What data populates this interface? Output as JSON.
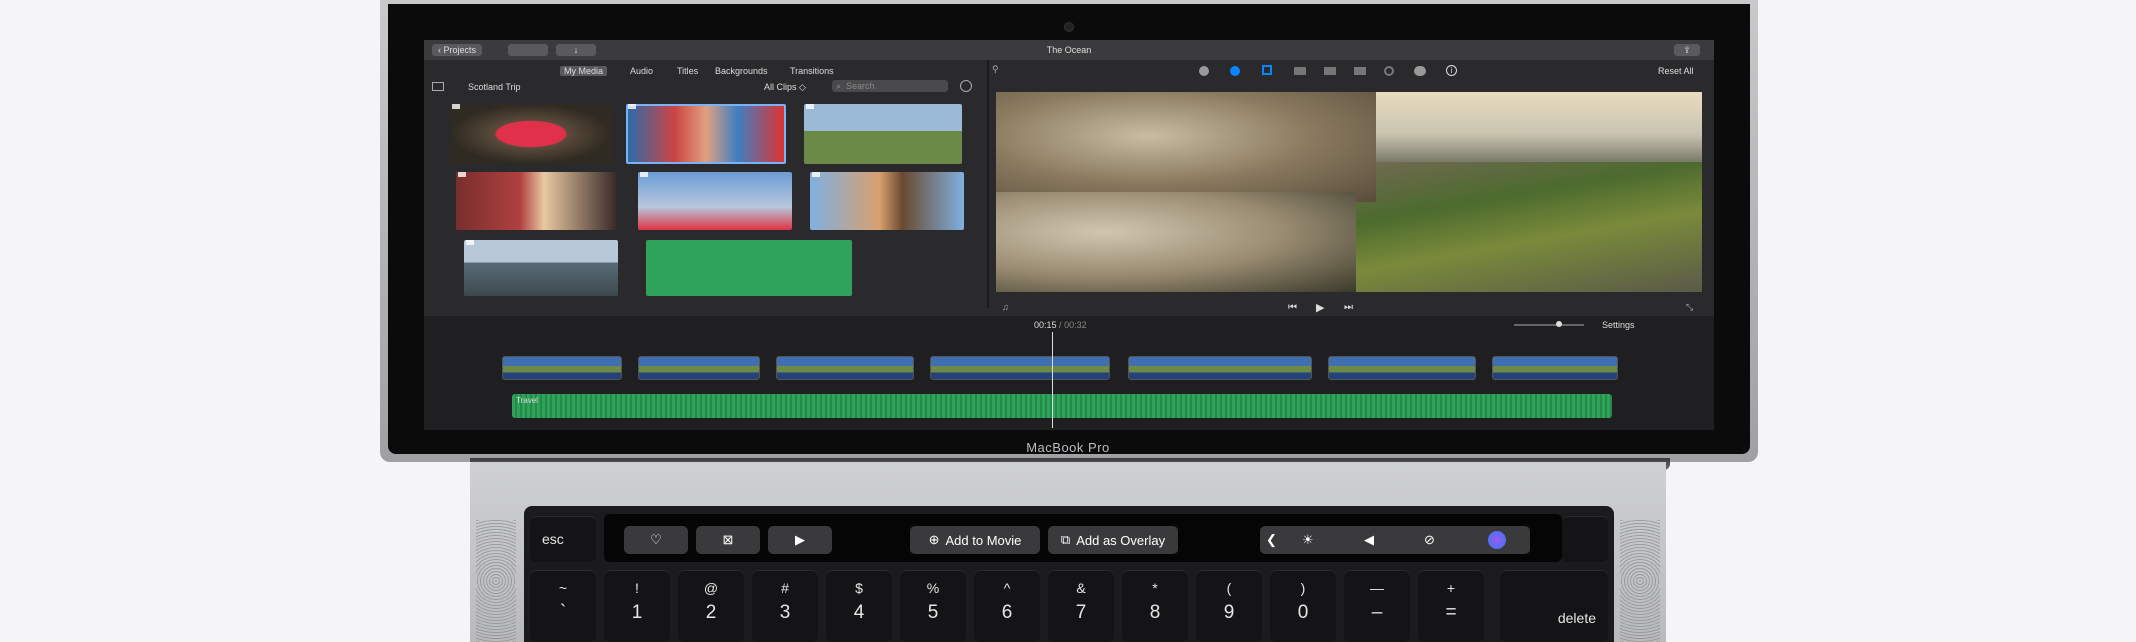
{
  "imovie": {
    "back_button": "Projects",
    "window_title": "The Ocean",
    "tabs": [
      "My Media",
      "Audio",
      "Titles",
      "Backgrounds",
      "Transitions"
    ],
    "library_name": "Scotland Trip",
    "filter": "All Clips",
    "search_placeholder": "Search",
    "reset_all": "Reset All",
    "time_current": "00:15",
    "time_separator": "/",
    "time_total": "00:32",
    "settings": "Settings",
    "audio_track_label": "Travel"
  },
  "device": {
    "brand_label": "MacBook Pro"
  },
  "touch_bar": {
    "esc": "esc",
    "add_to_movie": "Add to Movie",
    "add_as_overlay": "Add as Overlay"
  },
  "keys": [
    {
      "top": "~",
      "bottom": "`"
    },
    {
      "top": "!",
      "bottom": "1"
    },
    {
      "top": "@",
      "bottom": "2"
    },
    {
      "top": "#",
      "bottom": "3"
    },
    {
      "top": "$",
      "bottom": "4"
    },
    {
      "top": "%",
      "bottom": "5"
    },
    {
      "top": "^",
      "bottom": "6"
    },
    {
      "top": "&",
      "bottom": "7"
    },
    {
      "top": "*",
      "bottom": "8"
    },
    {
      "top": "(",
      "bottom": "9"
    },
    {
      "top": ")",
      "bottom": "0"
    },
    {
      "top": "—",
      "bottom": "–"
    },
    {
      "top": "+",
      "bottom": "="
    }
  ],
  "delete_key": "delete",
  "colors": {
    "accent_blue": "#0a84ff",
    "audio_green": "#2fa35a",
    "toolbar_bg": "#3a3a3c"
  }
}
